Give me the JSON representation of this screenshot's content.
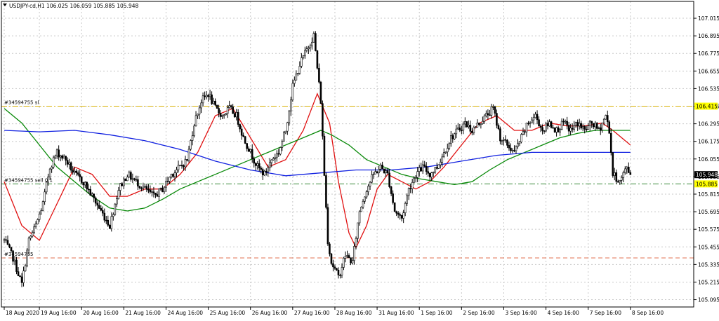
{
  "header": {
    "symbol_label": "USDJPY-cd,H1  106.025 106.059 105.885 105.948"
  },
  "chart_data": {
    "type": "candlestick",
    "symbol": "USDJPY-cd",
    "timeframe": "H1",
    "ohlc_header": {
      "open": 106.025,
      "high": 106.059,
      "low": 105.885,
      "close": 105.948
    },
    "last_price": 105.948,
    "ylim": [
      105.045,
      107.13
    ],
    "xlim_hours": [
      0,
      392
    ],
    "grid": true,
    "y_ticks": [
      107.015,
      106.895,
      106.775,
      106.655,
      106.535,
      106.415,
      106.295,
      106.175,
      106.055,
      105.935,
      105.815,
      105.695,
      105.575,
      105.455,
      105.335,
      105.215,
      105.095
    ],
    "x_ticks": [
      {
        "t": 0,
        "label": "18 Aug 2020"
      },
      {
        "t": 20,
        "label": "19 Aug 16:00"
      },
      {
        "t": 44,
        "label": "20 Aug 16:00"
      },
      {
        "t": 68,
        "label": "21 Aug 16:00"
      },
      {
        "t": 92,
        "label": "24 Aug 16:00"
      },
      {
        "t": 116,
        "label": "25 Aug 16:00"
      },
      {
        "t": 140,
        "label": "26 Aug 16:00"
      },
      {
        "t": 164,
        "label": "27 Aug 16:00"
      },
      {
        "t": 188,
        "label": "28 Aug 16:00"
      },
      {
        "t": 212,
        "label": "31 Aug 16:00"
      },
      {
        "t": 236,
        "label": "1 Sep 16:00"
      },
      {
        "t": 260,
        "label": "2 Sep 16:00"
      },
      {
        "t": 284,
        "label": "3 Sep 16:00"
      },
      {
        "t": 308,
        "label": "4 Sep 16:00"
      },
      {
        "t": 332,
        "label": "7 Sep 16:00"
      },
      {
        "t": 356,
        "label": "8 Sep 16:00"
      }
    ],
    "price_path": [
      [
        0,
        105.5
      ],
      [
        5,
        105.38
      ],
      [
        10,
        105.2
      ],
      [
        14,
        105.5
      ],
      [
        18,
        105.6
      ],
      [
        22,
        105.75
      ],
      [
        26,
        106.0
      ],
      [
        30,
        106.1
      ],
      [
        35,
        106.05
      ],
      [
        40,
        105.95
      ],
      [
        45,
        105.9
      ],
      [
        50,
        105.8
      ],
      [
        55,
        105.7
      ],
      [
        60,
        105.6
      ],
      [
        65,
        105.85
      ],
      [
        70,
        105.95
      ],
      [
        75,
        105.9
      ],
      [
        80,
        105.85
      ],
      [
        85,
        105.8
      ],
      [
        90,
        105.85
      ],
      [
        95,
        105.95
      ],
      [
        100,
        106.0
      ],
      [
        104,
        106.05
      ],
      [
        108,
        106.3
      ],
      [
        112,
        106.45
      ],
      [
        116,
        106.5
      ],
      [
        120,
        106.4
      ],
      [
        124,
        106.35
      ],
      [
        128,
        106.4
      ],
      [
        132,
        106.35
      ],
      [
        136,
        106.2
      ],
      [
        140,
        106.1
      ],
      [
        144,
        106.0
      ],
      [
        148,
        105.95
      ],
      [
        152,
        106.05
      ],
      [
        156,
        106.1
      ],
      [
        160,
        106.25
      ],
      [
        164,
        106.55
      ],
      [
        168,
        106.7
      ],
      [
        172,
        106.8
      ],
      [
        176,
        106.9
      ],
      [
        180,
        106.45
      ],
      [
        182,
        105.95
      ],
      [
        184,
        105.5
      ],
      [
        186,
        105.35
      ],
      [
        190,
        105.25
      ],
      [
        194,
        105.4
      ],
      [
        198,
        105.35
      ],
      [
        202,
        105.7
      ],
      [
        206,
        105.85
      ],
      [
        210,
        105.95
      ],
      [
        214,
        106.0
      ],
      [
        218,
        105.95
      ],
      [
        222,
        105.7
      ],
      [
        226,
        105.65
      ],
      [
        230,
        105.85
      ],
      [
        234,
        105.95
      ],
      [
        238,
        106.0
      ],
      [
        242,
        105.95
      ],
      [
        246,
        106.0
      ],
      [
        250,
        106.1
      ],
      [
        254,
        106.2
      ],
      [
        258,
        106.25
      ],
      [
        262,
        106.3
      ],
      [
        266,
        106.25
      ],
      [
        270,
        106.3
      ],
      [
        274,
        106.35
      ],
      [
        278,
        106.4
      ],
      [
        282,
        106.2
      ],
      [
        286,
        106.15
      ],
      [
        290,
        106.1
      ],
      [
        294,
        106.2
      ],
      [
        298,
        106.3
      ],
      [
        302,
        106.35
      ],
      [
        306,
        106.25
      ],
      [
        310,
        106.3
      ],
      [
        314,
        106.25
      ],
      [
        318,
        106.3
      ],
      [
        322,
        106.25
      ],
      [
        326,
        106.3
      ],
      [
        330,
        106.25
      ],
      [
        334,
        106.3
      ],
      [
        338,
        106.25
      ],
      [
        342,
        106.35
      ],
      [
        344,
        106.25
      ],
      [
        346,
        105.95
      ],
      [
        350,
        105.9
      ],
      [
        354,
        106.0
      ],
      [
        356,
        105.948
      ]
    ],
    "series": [
      {
        "name": "",
        "color": "#e01010",
        "values": [
          [
            0,
            105.9
          ],
          [
            10,
            105.6
          ],
          [
            20,
            105.5
          ],
          [
            30,
            105.75
          ],
          [
            40,
            106.0
          ],
          [
            50,
            105.95
          ],
          [
            60,
            105.8
          ],
          [
            70,
            105.8
          ],
          [
            80,
            105.85
          ],
          [
            90,
            105.85
          ],
          [
            100,
            105.95
          ],
          [
            110,
            106.1
          ],
          [
            120,
            106.35
          ],
          [
            130,
            106.4
          ],
          [
            140,
            106.2
          ],
          [
            150,
            106.0
          ],
          [
            160,
            106.05
          ],
          [
            170,
            106.25
          ],
          [
            178,
            106.5
          ],
          [
            185,
            106.3
          ],
          [
            190,
            105.9
          ],
          [
            196,
            105.55
          ],
          [
            200,
            105.45
          ],
          [
            206,
            105.6
          ],
          [
            212,
            105.85
          ],
          [
            218,
            105.95
          ],
          [
            226,
            105.9
          ],
          [
            234,
            105.85
          ],
          [
            242,
            105.9
          ],
          [
            250,
            106.0
          ],
          [
            260,
            106.15
          ],
          [
            270,
            106.3
          ],
          [
            280,
            106.35
          ],
          [
            290,
            106.25
          ],
          [
            300,
            106.25
          ],
          [
            310,
            106.3
          ],
          [
            320,
            106.28
          ],
          [
            330,
            106.28
          ],
          [
            340,
            106.3
          ],
          [
            346,
            106.25
          ],
          [
            356,
            106.15
          ]
        ]
      },
      {
        "name": "",
        "color": "#0a8a0a",
        "values": [
          [
            0,
            106.4
          ],
          [
            10,
            106.3
          ],
          [
            20,
            106.15
          ],
          [
            30,
            106.0
          ],
          [
            40,
            105.9
          ],
          [
            50,
            105.8
          ],
          [
            60,
            105.72
          ],
          [
            70,
            105.7
          ],
          [
            80,
            105.72
          ],
          [
            90,
            105.78
          ],
          [
            100,
            105.85
          ],
          [
            110,
            105.9
          ],
          [
            120,
            105.95
          ],
          [
            130,
            106.0
          ],
          [
            140,
            106.05
          ],
          [
            150,
            106.1
          ],
          [
            160,
            106.15
          ],
          [
            170,
            106.2
          ],
          [
            180,
            106.25
          ],
          [
            186,
            106.22
          ],
          [
            196,
            106.15
          ],
          [
            206,
            106.05
          ],
          [
            216,
            106.0
          ],
          [
            226,
            105.95
          ],
          [
            236,
            105.92
          ],
          [
            246,
            105.9
          ],
          [
            256,
            105.88
          ],
          [
            266,
            105.9
          ],
          [
            276,
            105.98
          ],
          [
            286,
            106.05
          ],
          [
            296,
            106.1
          ],
          [
            306,
            106.15
          ],
          [
            316,
            106.2
          ],
          [
            326,
            106.23
          ],
          [
            336,
            106.25
          ],
          [
            346,
            106.25
          ],
          [
            356,
            106.25
          ]
        ]
      },
      {
        "name": "",
        "color": "#1020e0",
        "values": [
          [
            0,
            106.25
          ],
          [
            20,
            106.24
          ],
          [
            40,
            106.25
          ],
          [
            60,
            106.22
          ],
          [
            80,
            106.18
          ],
          [
            100,
            106.12
          ],
          [
            120,
            106.04
          ],
          [
            140,
            105.98
          ],
          [
            160,
            105.94
          ],
          [
            180,
            105.96
          ],
          [
            200,
            105.98
          ],
          [
            220,
            105.98
          ],
          [
            240,
            106.0
          ],
          [
            260,
            106.04
          ],
          [
            280,
            106.08
          ],
          [
            300,
            106.1
          ],
          [
            320,
            106.1
          ],
          [
            340,
            106.1
          ],
          [
            356,
            106.1
          ]
        ]
      }
    ],
    "hlines": [
      {
        "label": "#34594755 sl",
        "price": 106.415,
        "color": "#d8b000",
        "dash": "8,3,2,3"
      },
      {
        "label": "#34594755 sell 0.1",
        "price": 105.885,
        "color": "#3a8a3a",
        "dash": "8,3,2,3"
      },
      {
        "label": "#34594755",
        "price": 105.38,
        "color": "#e07050",
        "dash": "6,4"
      }
    ],
    "price_labels": [
      {
        "price": 106.415,
        "text": "106.415",
        "bg": "#ffff00",
        "fg": "#000000"
      },
      {
        "price": 105.885,
        "text": "105.885",
        "bg": "#ffff00",
        "fg": "#000000"
      },
      {
        "price": 105.948,
        "text": "105.948",
        "bg": "#000000",
        "fg": "#ffffff"
      }
    ]
  }
}
